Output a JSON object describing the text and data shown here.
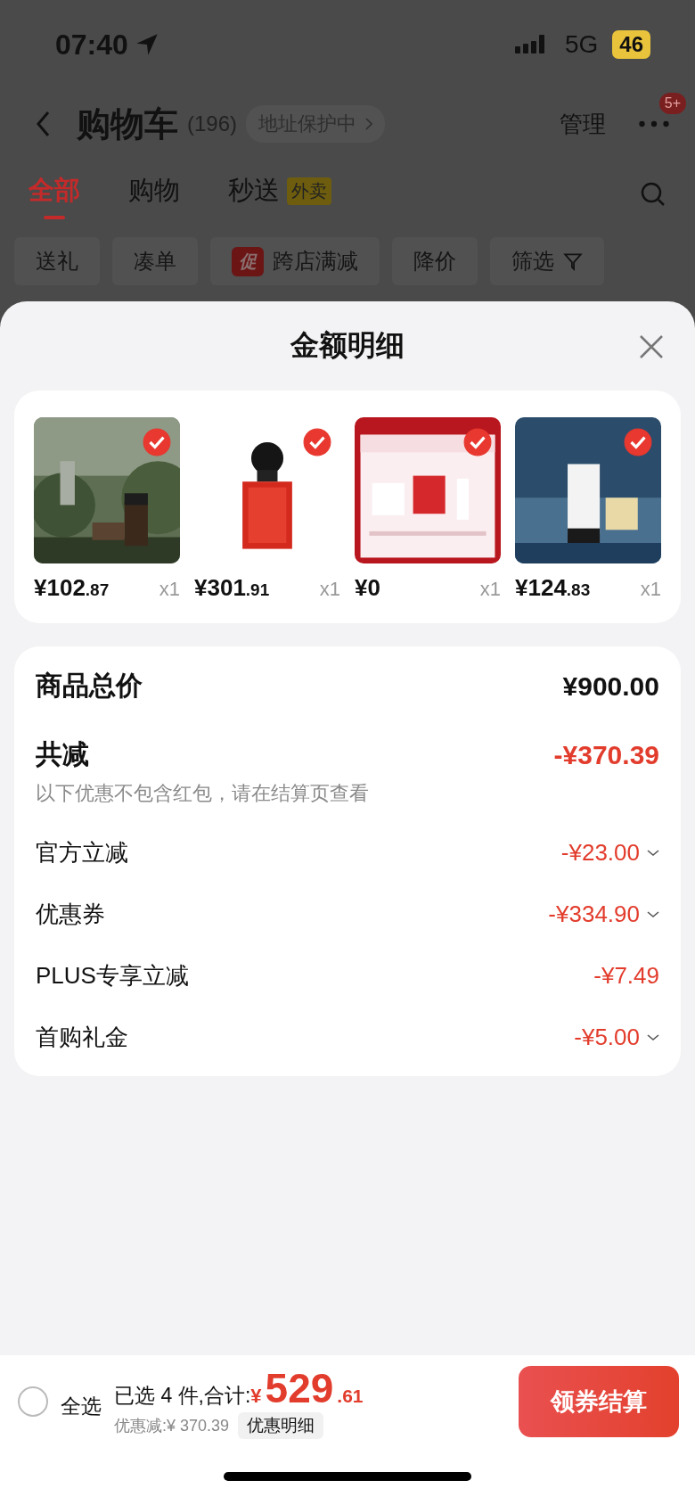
{
  "status_bar": {
    "time": "07:40",
    "network": "5G",
    "battery": "46"
  },
  "header": {
    "title": "购物车",
    "count": "(196)",
    "address_badge": "地址保护中",
    "manage": "管理",
    "more_badge": "5+"
  },
  "tabs": [
    {
      "label": "全部",
      "selected": true
    },
    {
      "label": "购物",
      "selected": false
    },
    {
      "label": "秒送",
      "selected": false,
      "tag": "外卖"
    }
  ],
  "chips": [
    {
      "label": "送礼",
      "kind": "plain"
    },
    {
      "label": "凑单",
      "kind": "plain"
    },
    {
      "label": "跨店满减",
      "kind": "promo",
      "tag": "促"
    },
    {
      "label": "降价",
      "kind": "plain"
    },
    {
      "label": "筛选",
      "kind": "filter"
    }
  ],
  "sheet": {
    "title": "金额明细",
    "products": [
      {
        "kind": "picture",
        "checked": true,
        "price": "¥102",
        "price_decimals": ".87",
        "quantity": "x1"
      },
      {
        "kind": "picture",
        "checked": true,
        "price": "¥301",
        "price_decimals": ".91",
        "quantity": "x1"
      },
      {
        "kind": "picture",
        "checked": true,
        "price": "¥0",
        "quantity": "x1"
      },
      {
        "kind": "picture",
        "checked": true,
        "price": "¥124",
        "price_decimals": ".83",
        "quantity": "x1"
      }
    ],
    "total": {
      "label": "商品总价",
      "value": "¥900.00"
    },
    "discount": {
      "label": "共减",
      "value": "-¥370.39",
      "note": "以下优惠不包含红包，请在结算页查看"
    },
    "discount_items": [
      {
        "label": "官方立减",
        "value": "-¥23.00",
        "expandable": true
      },
      {
        "label": "优惠券",
        "value": "-¥334.90",
        "expandable": true
      },
      {
        "label": "PLUS专享立减",
        "value": "-¥7.49",
        "expandable": false
      },
      {
        "label": "首购礼金",
        "value": "-¥5.00",
        "expandable": true
      }
    ]
  },
  "footer": {
    "select_all": {
      "label": "全选",
      "checked": false
    },
    "selected_text": "已选 4 件,合计:",
    "currency": "¥",
    "amount": "529",
    "amount_decimals": ".61",
    "saved": "优惠减:¥ 370.39",
    "detail_button": "优惠明细",
    "checkout": "领券结算"
  }
}
